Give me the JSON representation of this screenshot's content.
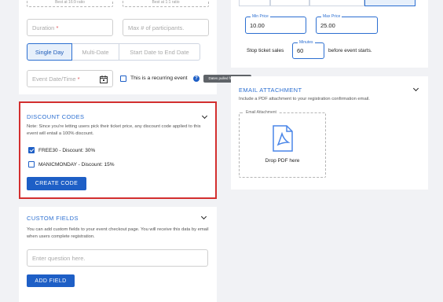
{
  "ratio_hints": [
    "Best at 16:9 ratio",
    "Best at 1:1 ratio"
  ],
  "form": {
    "duration_placeholder": "Duration",
    "participants_placeholder": "Max # of participants.",
    "required_mark": "*",
    "date_modes": [
      "Single Day",
      "Multi-Date",
      "Start Date to End Date"
    ],
    "event_date_placeholder": "Event Date/Time",
    "recurring_label": "This is a recurring event",
    "tooltip": "Dates pulled from Zoom"
  },
  "discount_codes": {
    "title": "DISCOUNT CODES",
    "note": "Note: Since you're letting users pick their ticket price, any discount code applied to this event will entail a 100% discount.",
    "codes": [
      {
        "label": "FREE30 - Discount: 30%",
        "checked": true
      },
      {
        "label": "MANICMONDAY - Discount: 15%",
        "checked": false
      }
    ],
    "create_button": "CREATE CODE"
  },
  "custom_fields": {
    "title": "CUSTOM FIELDS",
    "note": "You can add custom fields to your event checkout page. You will receive this data by email when users complete registration.",
    "question_placeholder": "Enter question here.",
    "add_button": "ADD FIELD"
  },
  "pricing": {
    "min_price_label": "Min Price",
    "min_price": "10.00",
    "max_price_label": "Max Price",
    "max_price": "25.00",
    "stop_sales_prefix": "Stop ticket sales",
    "minutes_label": "Minutes",
    "minutes_value": "60",
    "stop_sales_suffix": "before event starts."
  },
  "email_attachment": {
    "title": "EMAIL ATTACHMENT",
    "description": "Include a PDF attachment to your registration confirmation email.",
    "field_label": "Email Attachment",
    "drop_text": "Drop PDF here"
  },
  "colors": {
    "accent": "#1e5fc6",
    "highlight_border": "#d32f2f",
    "tooltip_bg": "#5f6368"
  }
}
